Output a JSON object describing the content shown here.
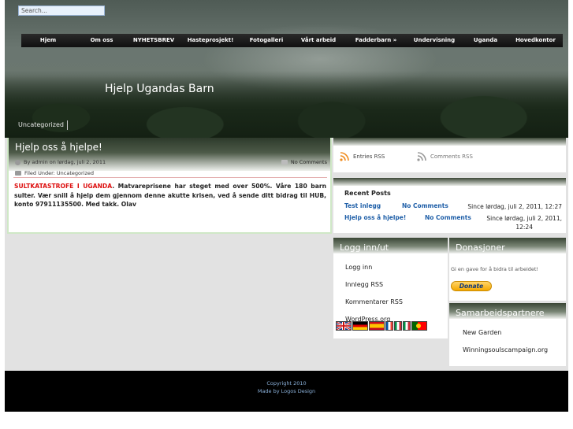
{
  "header": {
    "search_placeholder": "Search...",
    "site_title": "Hjelp Ugandas Barn",
    "category_link": "Uncategorized"
  },
  "nav": {
    "items": [
      "Hjem",
      "Om oss",
      "NYHETSBREV",
      "Hasteprosjekt!",
      "Fotogalleri",
      "Vårt arbeid",
      "Fadderbarn »",
      "Undervisning",
      "Uganda",
      "Hovedkontor"
    ]
  },
  "post": {
    "title": "Hjelp oss å hjelpe!",
    "byline": "By admin on lørdag, juli 2, 2011",
    "comments": "No Comments",
    "filed": "Filed Under: Uncategorized",
    "body_red": "SULTKATASTROFE I UGANDA",
    "body_text": ". Matvareprisene har steget med over 500%. Våre 180 barn sulter. Vær snill å hjelp dem gjennom denne akutte krisen, ved å sende ditt bidrag til HUB, konto 97911135500. Med takk. Olav"
  },
  "rss": {
    "entries": "Entries RSS",
    "comments": "Comments RSS"
  },
  "recent": {
    "title": "Recent Posts",
    "posts": [
      {
        "title": "Test inlegg",
        "comments": "No Comments",
        "date": "Since lørdag, juli 2, 2011, 12:27"
      },
      {
        "title": "Hjelp oss å hjelpe!",
        "comments": "No Comments",
        "date_line1": "Since lørdag, juli 2, 2011,",
        "date_line2": "12:24"
      }
    ]
  },
  "login": {
    "title": "Logg inn/ut",
    "items": [
      "Logg inn",
      "Innlegg RSS",
      "Kommentarer RSS",
      "WordPress.org"
    ]
  },
  "donations": {
    "title": "Donasjoner",
    "text": "Gi en gave for å bidra til arbeidet!",
    "button": "Donate"
  },
  "partners": {
    "title": "Samarbeidspartnere",
    "items": [
      "New Garden",
      "Winningsoulscampaign.org"
    ]
  },
  "footer": {
    "copyright": "Copyright 2010",
    "made_by": "Made by Logos Design"
  },
  "colors": {
    "accent_red": "#dd1111",
    "link_blue": "#1f5fa8",
    "footer_link": "#8ab0d9"
  }
}
